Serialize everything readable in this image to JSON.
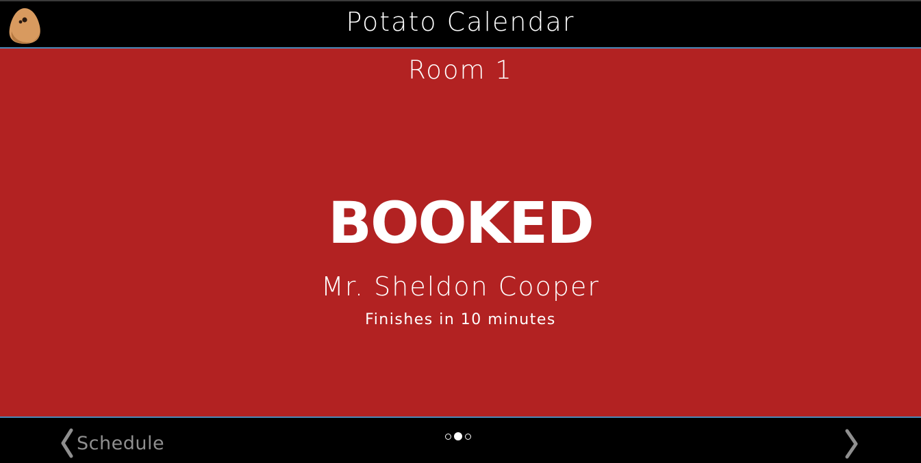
{
  "header": {
    "title": "Potato Calendar",
    "logo_icon": "potato-icon"
  },
  "room": {
    "name": "Room 1",
    "status": "BOOKED",
    "booked_by": "Mr. Sheldon Cooper",
    "finish_text": "Finishes in 10 minutes",
    "status_color": "#b22222"
  },
  "footer": {
    "prev_label": "Schedule",
    "prev_icon": "chevron-left-icon",
    "next_icon": "chevron-right-icon",
    "pages": [
      {
        "active": false
      },
      {
        "active": true
      },
      {
        "active": false
      }
    ]
  },
  "colors": {
    "background": "#000000",
    "accent_line": "#4a89b8",
    "nav_text": "#8f8f8f"
  }
}
